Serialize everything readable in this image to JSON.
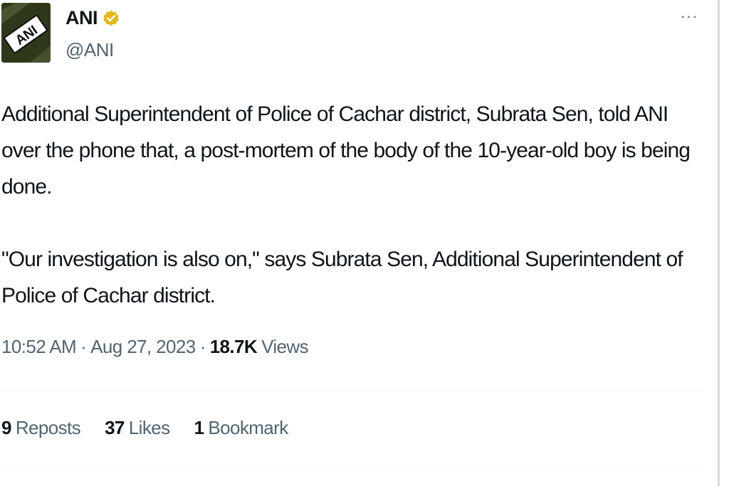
{
  "author": {
    "name": "ANI",
    "handle": "@ANI",
    "avatar_text": "ANI",
    "verified_color": "#e2b719"
  },
  "menu": {
    "more_label": "···"
  },
  "tweet": {
    "paragraph_1": "Additional Superintendent of Police of Cachar district, Subrata Sen, told ANI over the phone that, a post-mortem of the body of the 10-year-old boy is being done.",
    "paragraph_2": "\"Our investigation is also on,\" says Subrata Sen, Additional Superintendent of Police of Cachar district."
  },
  "meta": {
    "time": "10:52 AM",
    "date": "Aug 27, 2023",
    "separator": "·",
    "views_count": "18.7K",
    "views_label": "Views"
  },
  "stats": {
    "reposts_count": "9",
    "reposts_label": "Reposts",
    "likes_count": "37",
    "likes_label": "Likes",
    "bookmarks_count": "1",
    "bookmarks_label": "Bookmark"
  },
  "colors": {
    "text_primary": "#0f1419",
    "text_secondary": "#536471",
    "divider": "#eff3f4"
  }
}
